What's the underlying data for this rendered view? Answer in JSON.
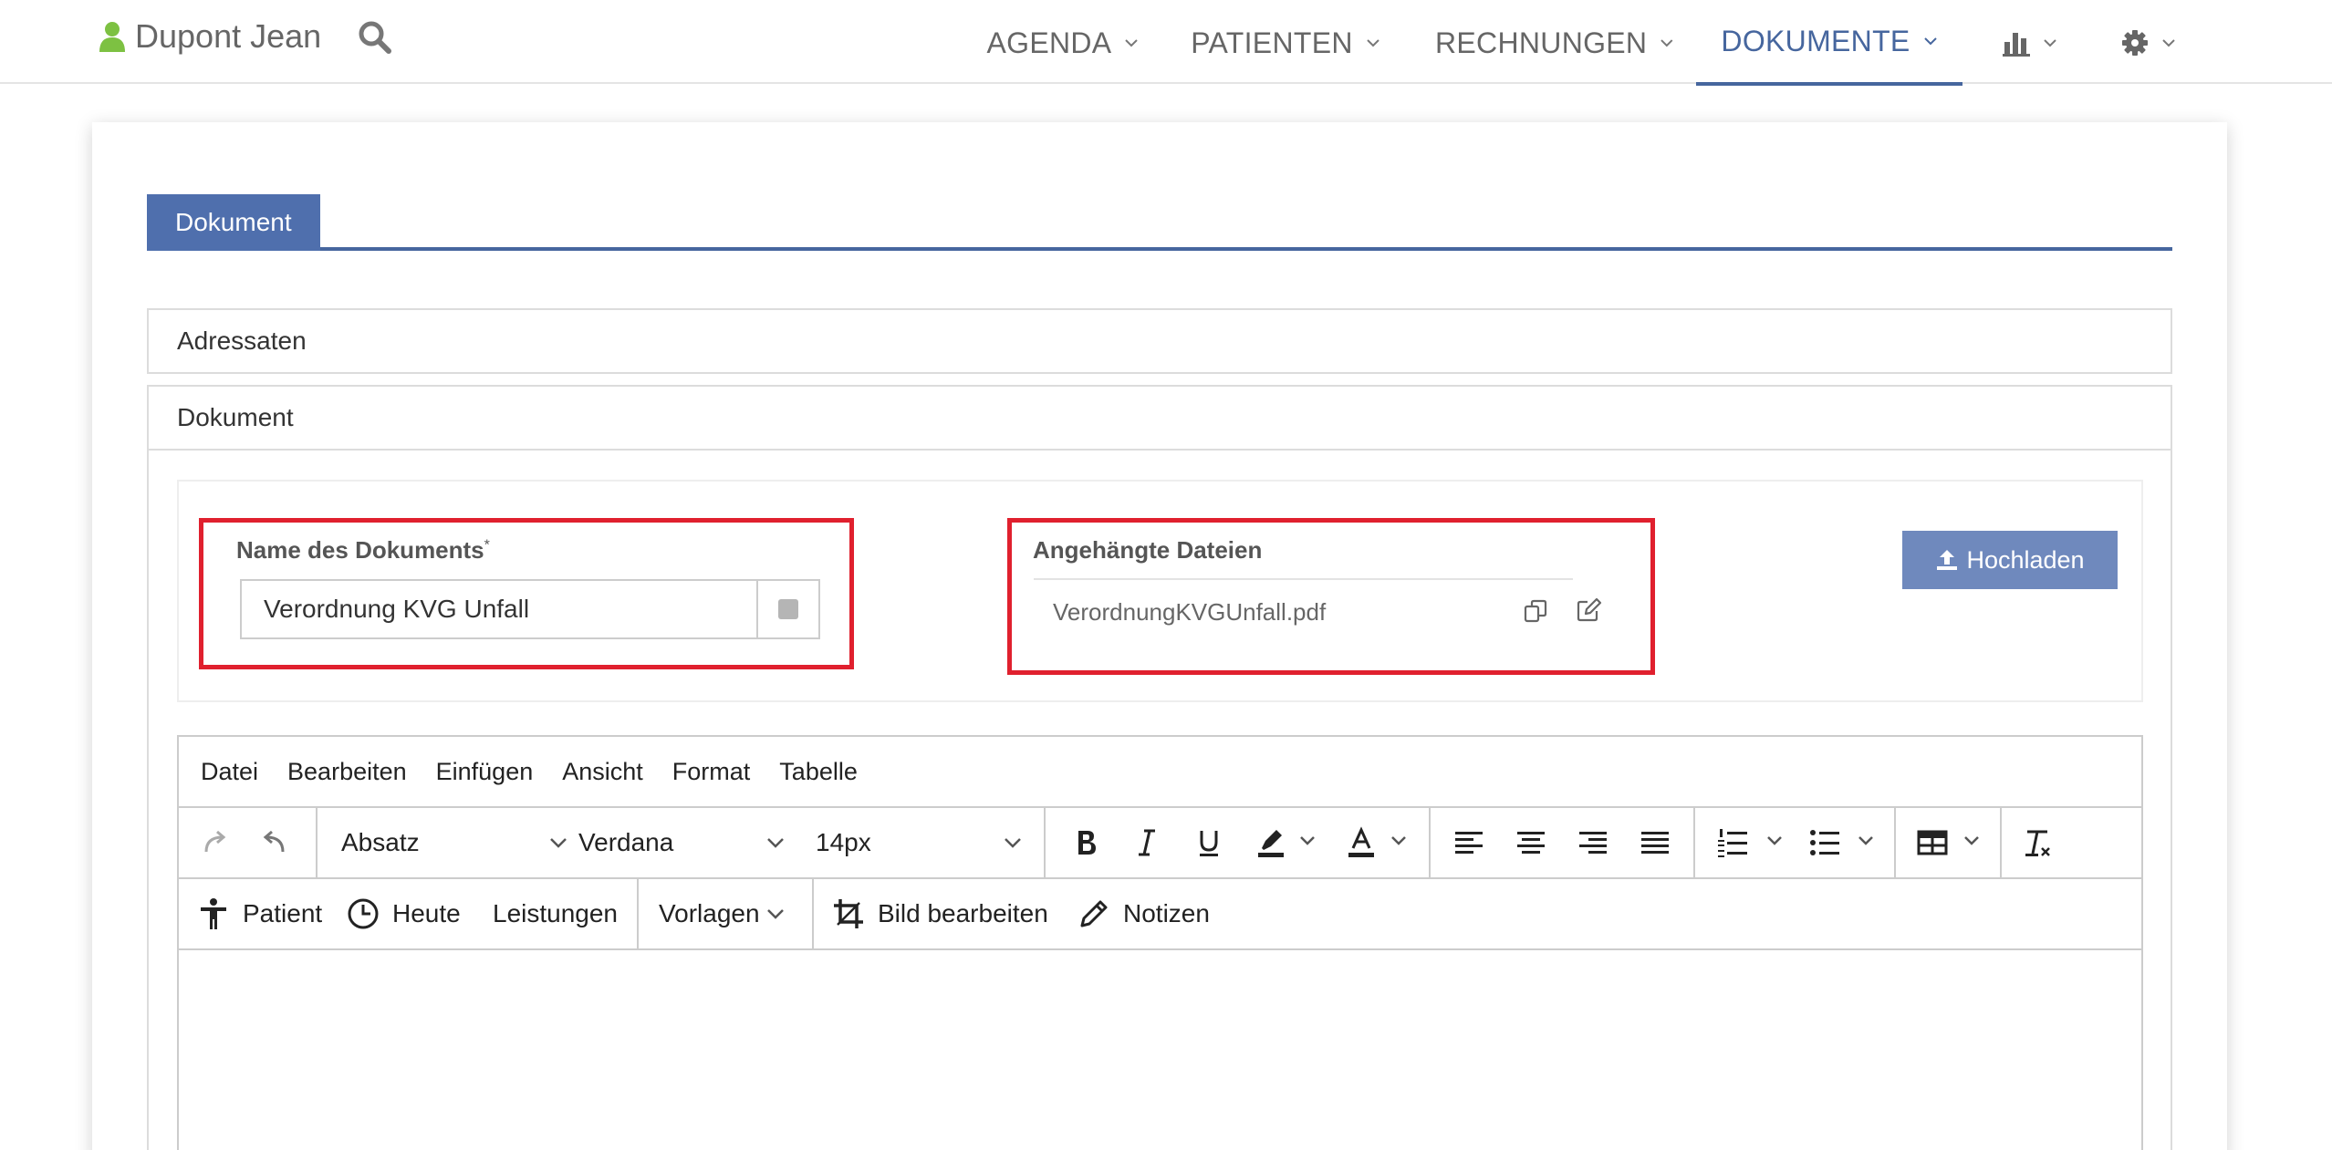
{
  "header": {
    "user_name": "Dupont Jean",
    "nav": [
      {
        "label": "AGENDA"
      },
      {
        "label": "PATIENTEN"
      },
      {
        "label": "RECHNUNGEN"
      },
      {
        "label": "DOKUMENTE",
        "active": true
      },
      {
        "icon": "bar-chart-icon"
      },
      {
        "icon": "gear-icon"
      }
    ]
  },
  "tabs": [
    {
      "label": "Dokument",
      "active": true
    }
  ],
  "panels": {
    "addressees": "Adressaten",
    "document": "Dokument"
  },
  "document": {
    "name_label": "Name des Dokuments",
    "required_marker": "*",
    "name_value": "Verordnung KVG Unfall",
    "attachments_label": "Angehängte Dateien",
    "files": [
      {
        "name": "VerordnungKVGUnfall.pdf"
      }
    ],
    "upload_label": "Hochladen"
  },
  "editor": {
    "menus": [
      "Datei",
      "Bearbeiten",
      "Einfügen",
      "Ansicht",
      "Format",
      "Tabelle"
    ],
    "block_format": "Absatz",
    "font_family": "Verdana",
    "font_size": "14px",
    "toolbar2": {
      "patient": "Patient",
      "today": "Heute",
      "services": "Leistungen",
      "templates": "Vorlagen",
      "edit_image": "Bild bearbeiten",
      "notes": "Notizen"
    }
  },
  "colors": {
    "accent": "#46669e",
    "tab": "#4f6fad",
    "upload": "#6f89bd",
    "highlight": "#e0202e",
    "user_icon": "#7dc142"
  }
}
